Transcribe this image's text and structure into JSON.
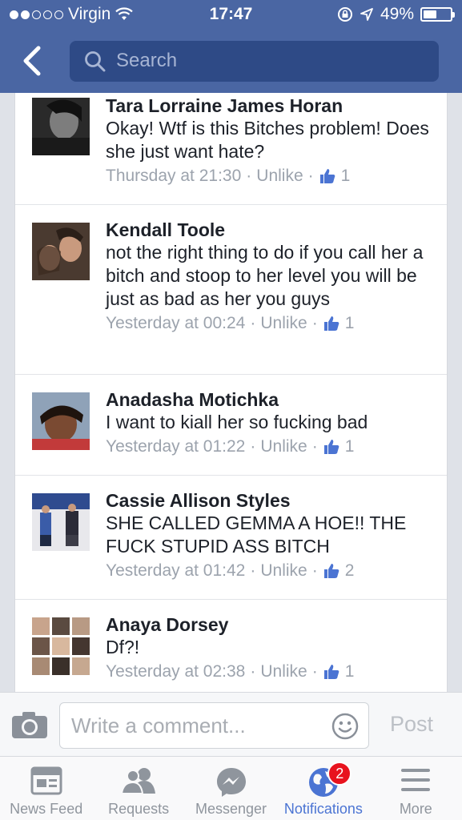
{
  "status_bar": {
    "carrier": "Virgin",
    "time": "17:47",
    "battery_text": "49%",
    "battery_level": 0.49,
    "signal_bars_filled": 2,
    "signal_bars_total": 5
  },
  "header": {
    "search_placeholder": "Search",
    "bg_color": "#4a66a3"
  },
  "comments": [
    {
      "name": "Tara Lorraine James Horan",
      "text": "Okay! Wtf is this Bitches problem! Does she just want hate?",
      "time": "Thursday at 21:30",
      "unlike": "Unlike",
      "likes": "1"
    },
    {
      "name": "Kendall Toole",
      "text": "not the right thing to do if you call her a bitch and stoop to her level you will be just as bad as her you guys",
      "time": "Yesterday at 00:24",
      "unlike": "Unlike",
      "likes": "1"
    },
    {
      "name": "Anadasha Motichka",
      "text": "I want to kiall her so fucking bad",
      "time": "Yesterday at 01:22",
      "unlike": "Unlike",
      "likes": "1"
    },
    {
      "name": "Cassie Allison Styles",
      "text": "SHE CALLED GEMMA A HOE!! THE FUCK STUPID ASS BITCH",
      "time": "Yesterday at 01:42",
      "unlike": "Unlike",
      "likes": "2"
    },
    {
      "name": "Anaya Dorsey",
      "text": "Df?!",
      "time": "Yesterday at 02:38",
      "unlike": "Unlike",
      "likes": "1"
    }
  ],
  "compose": {
    "placeholder": "Write a comment...",
    "post_label": "Post"
  },
  "tabs": [
    {
      "label": "News Feed",
      "icon": "news-feed-icon"
    },
    {
      "label": "Requests",
      "icon": "requests-icon"
    },
    {
      "label": "Messenger",
      "icon": "messenger-icon"
    },
    {
      "label": "Notifications",
      "icon": "globe-icon",
      "active": true,
      "badge": "2"
    },
    {
      "label": "More",
      "icon": "menu-icon"
    }
  ],
  "colors": {
    "accent": "#4b74d3",
    "meta": "#9ca3ad",
    "badge": "#e8131e"
  }
}
